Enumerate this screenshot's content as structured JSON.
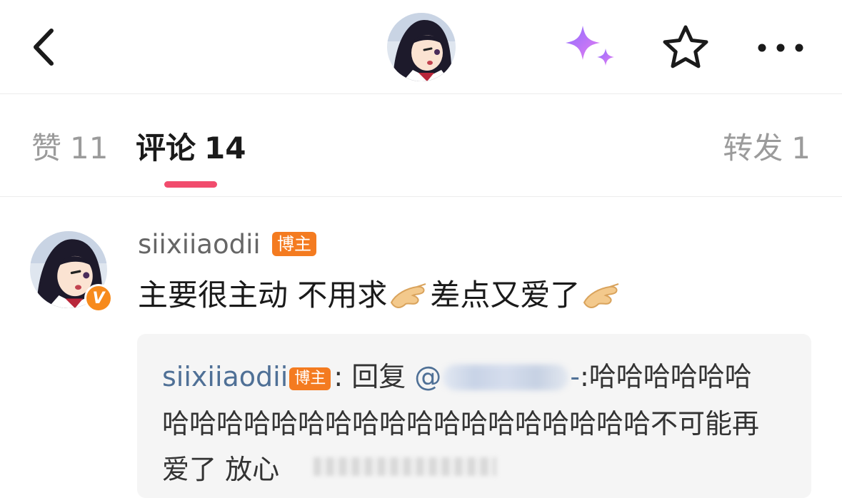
{
  "header": {
    "back_icon": "chevron-left-icon",
    "ai_icon": "sparkle-icon",
    "favorite_icon": "star-icon",
    "more_icon": "more-dots-icon",
    "accent_sparkle": "#b477ff"
  },
  "tabs": [
    {
      "label": "赞",
      "count": "11"
    },
    {
      "label": "评论",
      "count": "14"
    },
    {
      "label": "转发",
      "count": "1"
    }
  ],
  "active_tab_color": "#f14c6d",
  "comment": {
    "username": "siixiiaodii",
    "badge": "博主",
    "verified_mark": "V",
    "text_part1": "主要很主动 不用求",
    "text_part2": "差点又爱了",
    "emoji": "pinching-hand-icon"
  },
  "reply": {
    "username": "siixiiaodii",
    "badge": "博主",
    "prefix": ": 回复 ",
    "mention_at": "@",
    "mention_suffix": "-",
    "line1_text": ":哈哈哈哈哈哈",
    "line2_text": "哈哈哈哈哈哈哈哈哈哈哈哈哈哈哈哈哈哈不可能再",
    "line3_text": "爱了 放心"
  }
}
